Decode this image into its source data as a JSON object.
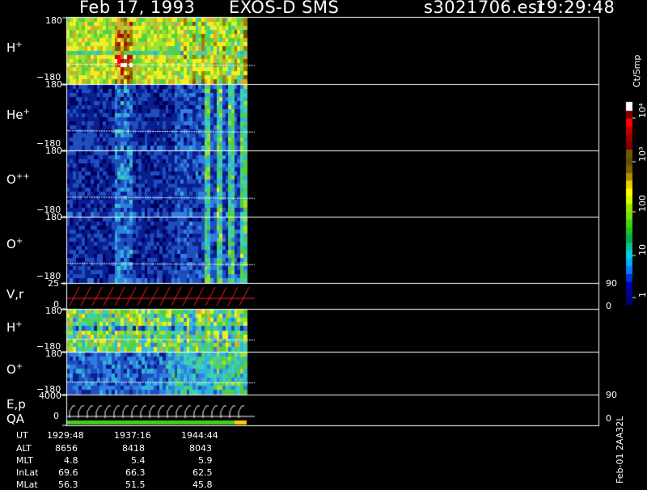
{
  "header": {
    "date": "Feb 17, 1993",
    "mission": "EXOS-D SMS",
    "file": "s3021706.esr",
    "time": "19:29:48"
  },
  "chart_data": {
    "type": "heatmap",
    "panels": [
      {
        "label": "H",
        "sup": "+",
        "ymax": "180",
        "ymin": "−180"
      },
      {
        "label": "He",
        "sup": "+",
        "ymax": "180",
        "ymin": "−180"
      },
      {
        "label": "O",
        "sup": "++",
        "ymax": "180",
        "ymin": "−180"
      },
      {
        "label": "O",
        "sup": "+",
        "ymax": "180",
        "ymin": "−180"
      },
      {
        "label": "V,r",
        "sup": "",
        "ymax": "25",
        "ymin": "0",
        "rmax": "90",
        "rmin": "0"
      },
      {
        "label": "H",
        "sup": "+",
        "ymax": "180",
        "ymin": "−180"
      },
      {
        "label": "O",
        "sup": "+",
        "ymax": "180",
        "ymin": "−180"
      },
      {
        "label": "E,p",
        "label2": "QA",
        "sup": "",
        "ymax": "4000",
        "ymin": "0",
        "rmax": "90",
        "rmin": "0"
      }
    ],
    "colorbar": {
      "unit": "Ct/Smp",
      "ticks": [
        "1",
        "10",
        "100",
        "10³",
        "10⁴"
      ]
    },
    "orbit": {
      "rows": [
        "UT",
        "ALT",
        "MLT",
        "InLat",
        "MLat"
      ],
      "columns": [
        [
          "1929:48",
          "8656",
          "4.8",
          "69.6",
          "56.3"
        ],
        [
          "1937:16",
          "8418",
          "5.4",
          "66.3",
          "51.5"
        ],
        [
          "1944:44",
          "8043",
          "5.9",
          "62.5",
          "45.8"
        ]
      ]
    },
    "footer_code": "Feb-01 2AA32L"
  }
}
